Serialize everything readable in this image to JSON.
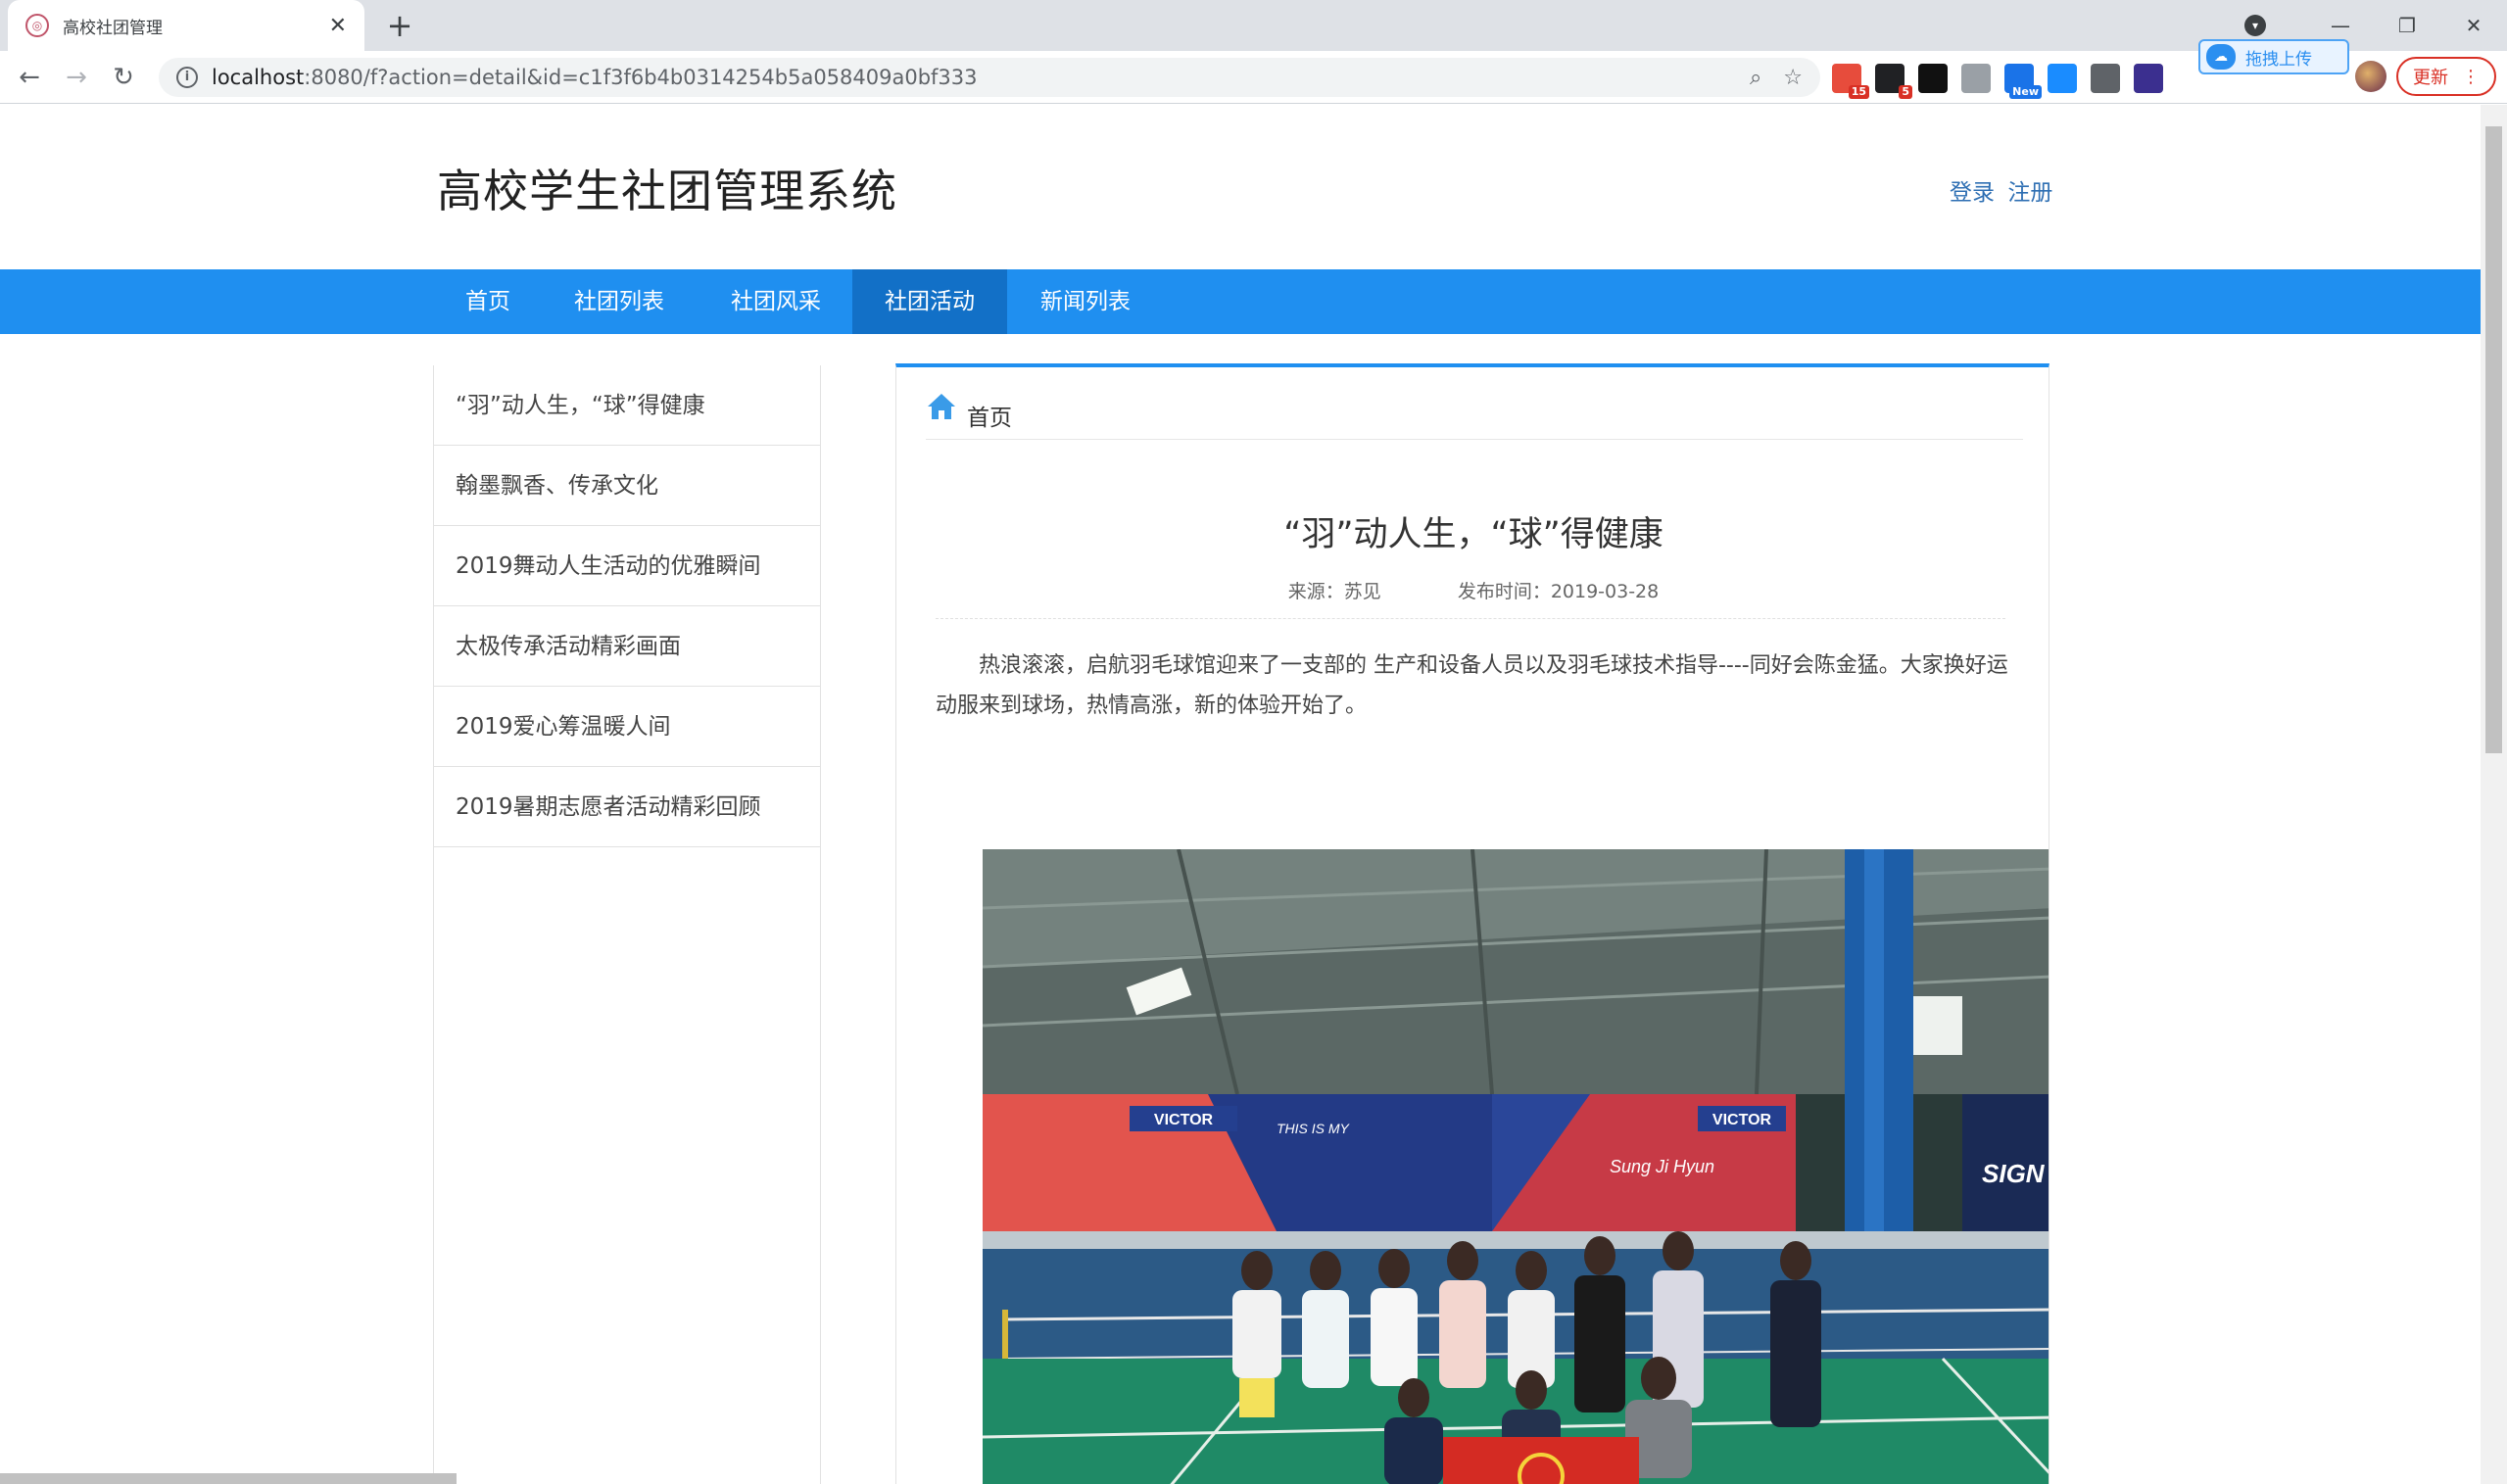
{
  "browser": {
    "tab_title": "高校社团管理",
    "tab_close": "✕",
    "new_tab": "+",
    "url_host": "localhost",
    "url_rest": ":8080/f?action=detail&id=c1f3f6b4b0314254b5a058409a0bf333",
    "extensions": [
      {
        "name": "ext-1",
        "badge": "15",
        "color": "#e74c3c"
      },
      {
        "name": "ext-2",
        "badge": "5",
        "color": "#202124"
      },
      {
        "name": "ext-3",
        "badge": "",
        "color": "#111111"
      },
      {
        "name": "ext-4",
        "badge": "",
        "color": "#9aa0a6"
      },
      {
        "name": "ext-5",
        "badge": "New",
        "color": "#1a73e8"
      },
      {
        "name": "ext-6",
        "badge": "",
        "color": "#1a8cff"
      },
      {
        "name": "ext-7",
        "badge": "",
        "color": "#5f6368"
      },
      {
        "name": "ext-8",
        "badge": "",
        "color": "#3b2f8f"
      }
    ],
    "upload_label": "拖拽上传",
    "update_label": "更新"
  },
  "site": {
    "title": "高校学生社团管理系统",
    "login": "登录",
    "register": "注册"
  },
  "nav": {
    "items": [
      "首页",
      "社团列表",
      "社团风采",
      "社团活动",
      "新闻列表"
    ],
    "active_index": 3
  },
  "sidebar": {
    "items": [
      "“羽”动人生，“球”得健康",
      "翰墨飘香、传承文化",
      "2019舞动人生活动的优雅瞬间",
      "太极传承活动精彩画面",
      "2019爱心筹温暖人间",
      "2019暑期志愿者活动精彩回顾"
    ]
  },
  "article": {
    "breadcrumb": "首页",
    "title": "“羽”动人生，“球”得健康",
    "source": "来源：苏见",
    "published": "发布时间：2019-03-28",
    "body": "热浪滚滚，启航羽毛球馆迎来了一支部的 生产和设备人员以及羽毛球技术指导----同好会陈金猛。大家换好运动服来到球场，热情高涨，新的体验开始了。",
    "photo_banners": [
      "VICTOR",
      "VICTOR",
      "THIS IS MY",
      "Sung Ji Hyun",
      "SIGN"
    ]
  },
  "colors": {
    "nav_bg": "#1f8ff0",
    "nav_active": "#1270c7",
    "link": "#2e6fb3"
  }
}
